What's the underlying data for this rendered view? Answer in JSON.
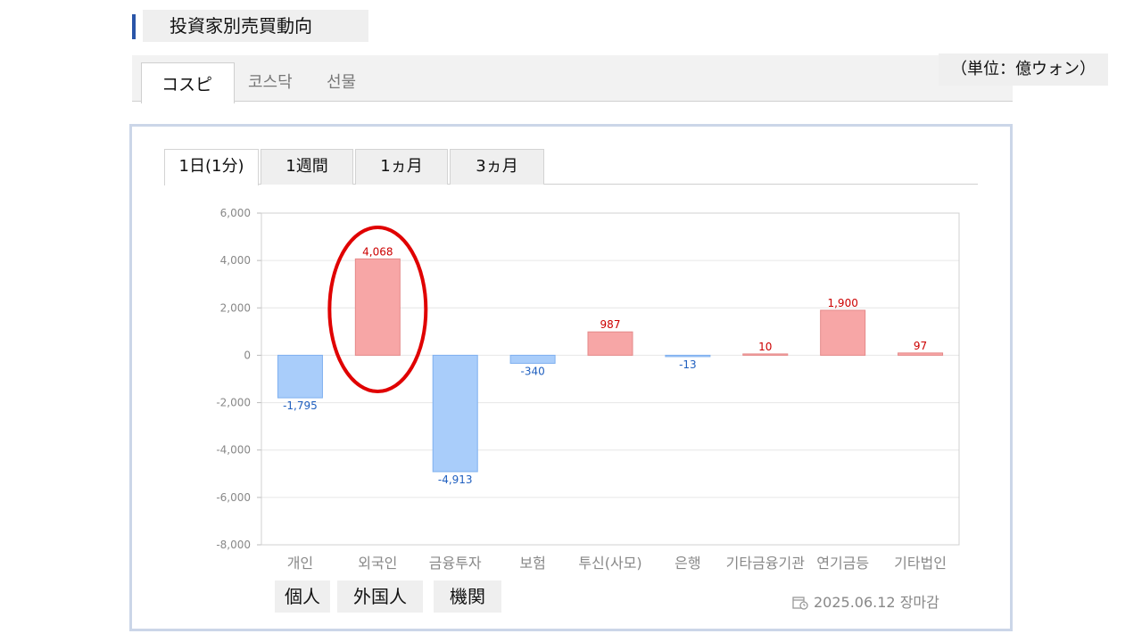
{
  "title": "投資家別売買動向",
  "unit": "（単位：億ウォン）",
  "market_tabs": [
    "コスピ",
    "코스닥",
    "선물"
  ],
  "period_tabs": [
    "1日(1分)",
    "1週間",
    "1ヵ月",
    "3ヵ月"
  ],
  "highlights": [
    "個人",
    "外国人",
    "機関"
  ],
  "footer": {
    "date": "2025.06.12 장마감"
  },
  "colors": {
    "positive_fill": "#f7a6a6",
    "positive_label": "#cc0000",
    "negative_fill": "#a9cdfa",
    "negative_label": "#1f5fbf",
    "circle": "#e00000",
    "accent": "#2a55a8"
  },
  "icons": {
    "footer": "calendar-clock-icon"
  },
  "chart_data": {
    "type": "bar",
    "categories": [
      "개인",
      "외국인",
      "금융투자",
      "보험",
      "투신(사모)",
      "은행",
      "기타금융",
      "기관",
      "연기금등",
      "기타법인"
    ],
    "tick_labels": [
      "개인",
      "외국인",
      "금융투자",
      "보험",
      "투신(사모)",
      "은행",
      "기타금융기관",
      "연기금등",
      "기타법인"
    ],
    "values": [
      -1795,
      4068,
      -4913,
      -340,
      987,
      -13,
      10,
      1900,
      97
    ],
    "value_labels": [
      "-1,795",
      "4,068",
      "-4,913",
      "-340",
      "987",
      "-13",
      "10",
      "1,900",
      "97"
    ],
    "y_ticks": [
      "6,000",
      "4,000",
      "2,000",
      "0",
      "-2,000",
      "-4,000",
      "-6,000",
      "-8,000"
    ],
    "ylim": [
      -8000,
      6000
    ],
    "grid": true,
    "title": "",
    "xlabel": "",
    "ylabel": ""
  }
}
